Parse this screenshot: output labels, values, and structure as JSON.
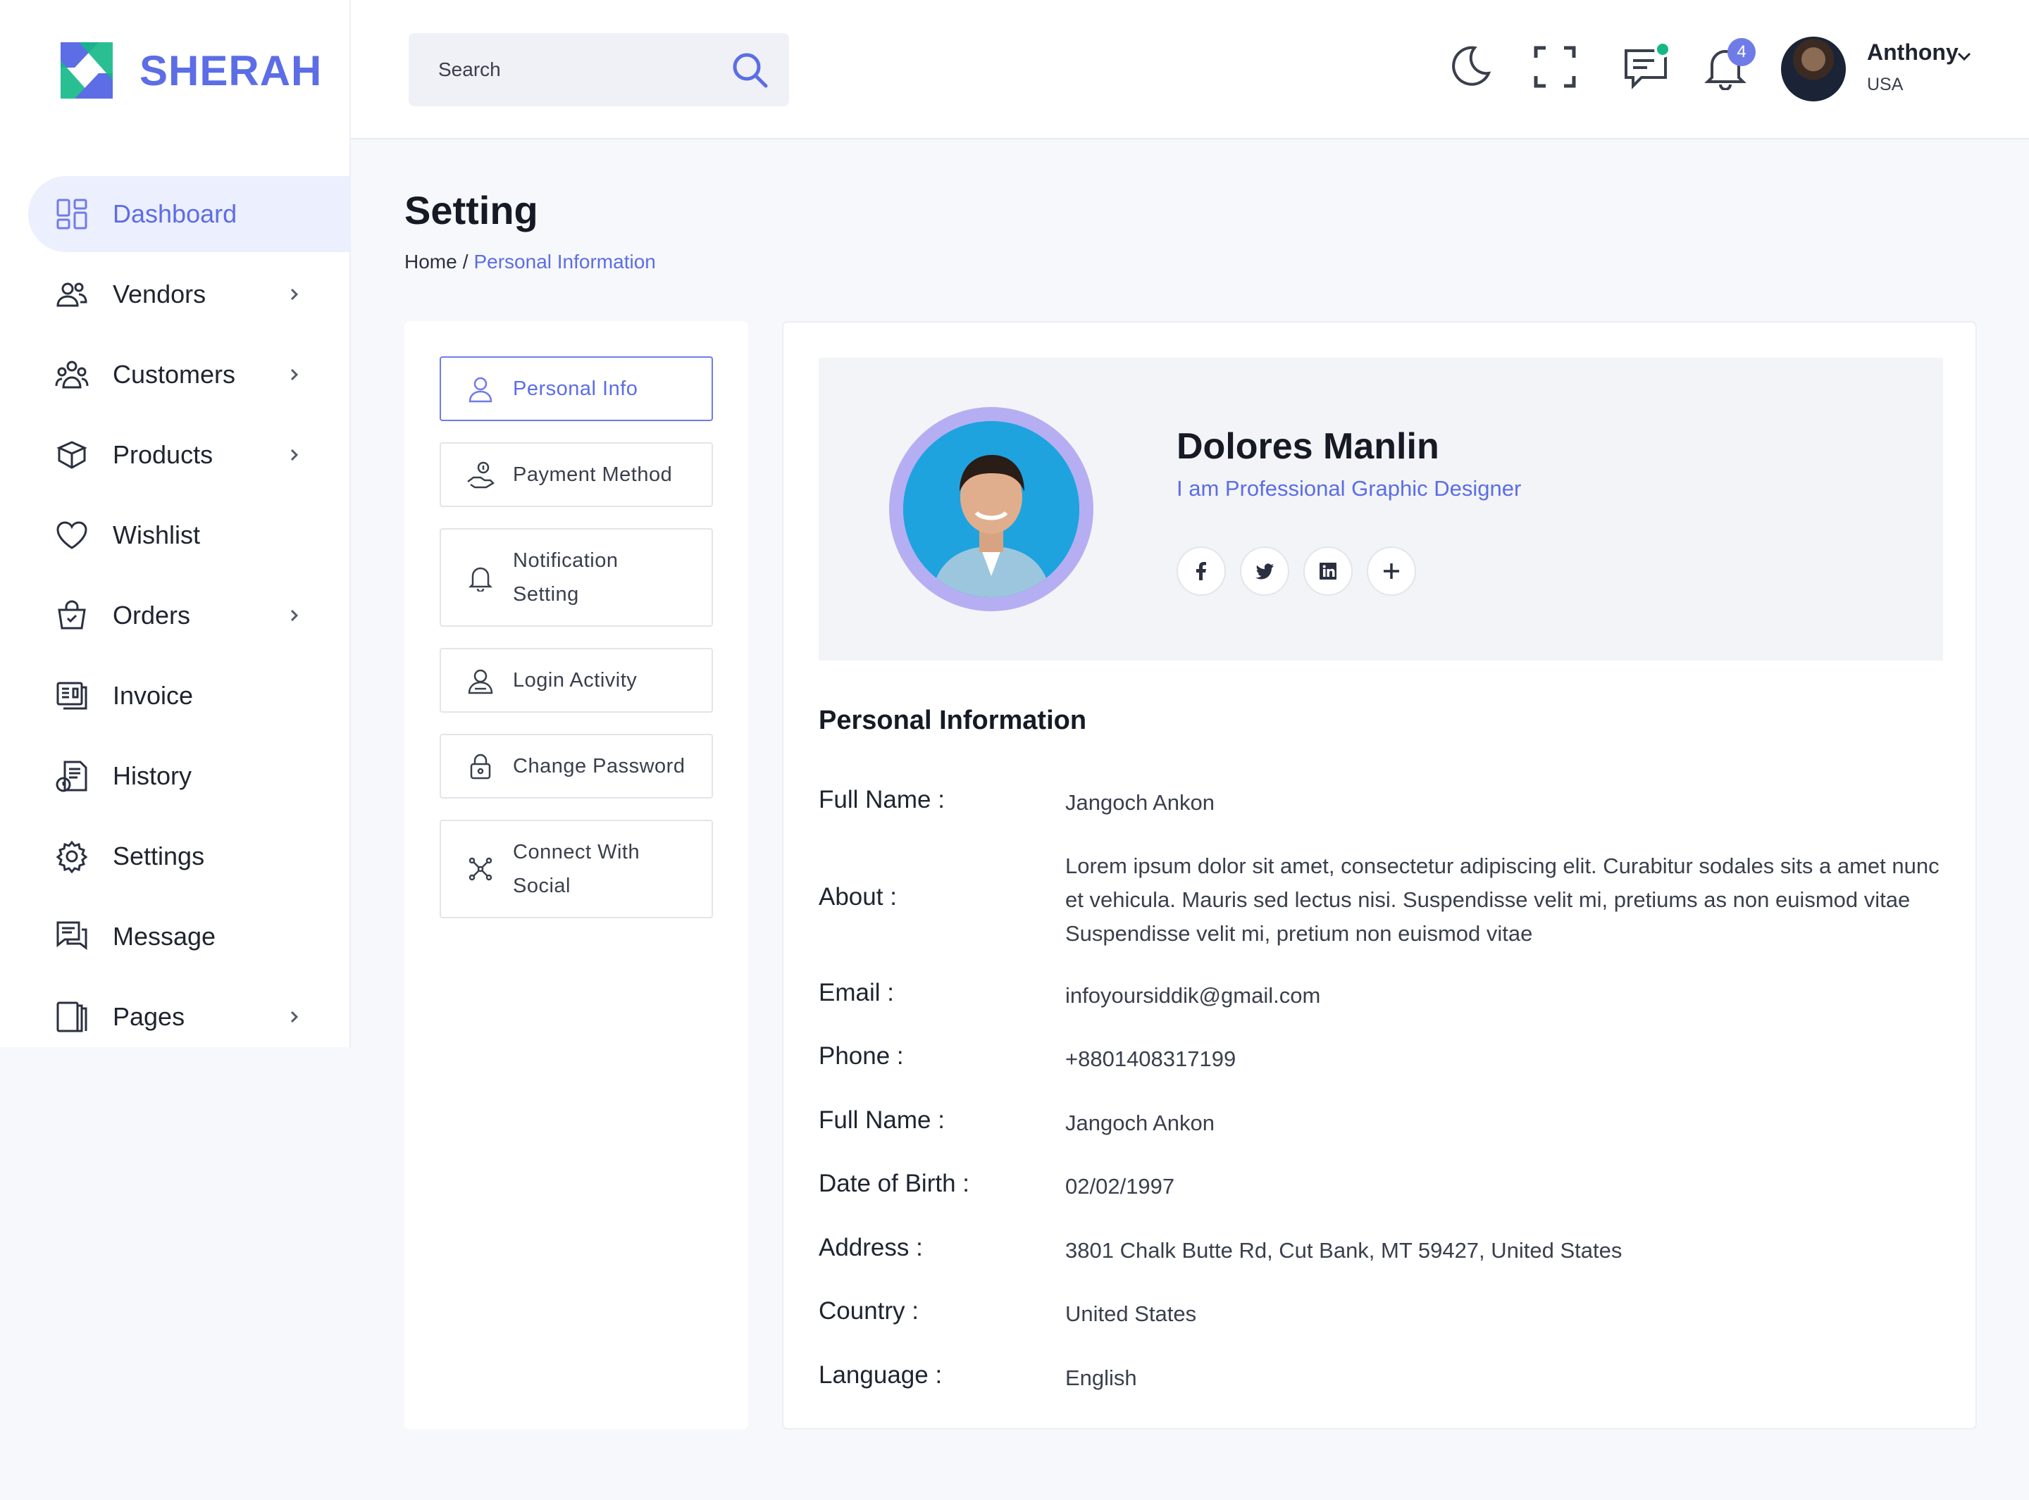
{
  "brand": {
    "name": "SHERAH",
    "logo_icon": "sherah-logo"
  },
  "sidebar": {
    "items": [
      {
        "label": "Dashboard",
        "icon": "dashboard-icon",
        "active": true,
        "has_children": false
      },
      {
        "label": "Vendors",
        "icon": "users-icon",
        "has_children": true
      },
      {
        "label": "Customers",
        "icon": "customers-icon",
        "has_children": true
      },
      {
        "label": "Products",
        "icon": "box-icon",
        "has_children": true
      },
      {
        "label": "Wishlist",
        "icon": "heart-icon",
        "has_children": false
      },
      {
        "label": "Orders",
        "icon": "basket-icon",
        "has_children": true
      },
      {
        "label": "Invoice",
        "icon": "invoice-icon",
        "has_children": false
      },
      {
        "label": "History",
        "icon": "history-icon",
        "has_children": false
      },
      {
        "label": "Settings",
        "icon": "gear-icon",
        "has_children": false
      },
      {
        "label": "Message",
        "icon": "message-icon",
        "has_children": false
      },
      {
        "label": "Pages",
        "icon": "pages-icon",
        "has_children": true
      }
    ]
  },
  "header": {
    "search_placeholder": "Search",
    "notification_count": "4",
    "user": {
      "name": "Anthony",
      "country": "USA"
    }
  },
  "page": {
    "title": "Setting",
    "breadcrumb": {
      "home": "Home",
      "separator": "/",
      "current": "Personal Information"
    }
  },
  "settings_menu": {
    "items": [
      {
        "label": "Personal Info",
        "icon": "user-icon",
        "active": true
      },
      {
        "label": "Payment Method",
        "icon": "payment-icon"
      },
      {
        "label": "Notification Setting",
        "line1": "Notification",
        "line2": "Setting",
        "icon": "bell-icon"
      },
      {
        "label": "Login Activity",
        "icon": "login-activity-icon"
      },
      {
        "label": "Change Password",
        "icon": "lock-icon"
      },
      {
        "label": "Connect With Social",
        "line1": "Connect With",
        "line2": "Social",
        "icon": "share-icon"
      }
    ]
  },
  "profile": {
    "name": "Dolores Manlin",
    "role": "I am Professional Graphic Designer",
    "socials": [
      "facebook-icon",
      "twitter-icon",
      "linkedin-icon",
      "plus-icon"
    ]
  },
  "personal_info": {
    "title": "Personal Information",
    "rows": [
      {
        "label": "Full Name :",
        "value": "Jangoch Ankon"
      },
      {
        "label": "About :",
        "value": "Lorem ipsum dolor sit amet, consectetur adipiscing elit. Curabitur sodales sits a amet nunc et vehicula. Mauris sed lectus nisi. Suspendisse velit mi, pretiums as non euismod vitae Suspendisse velit mi, pretium non euismod vitae"
      },
      {
        "label": "Email :",
        "value": "infoyoursiddik@gmail.com"
      },
      {
        "label": "Phone :",
        "value": "+8801408317199"
      },
      {
        "label": "Full Name :",
        "value": "Jangoch Ankon"
      },
      {
        "label": "Date of Birth :",
        "value": "02/02/1997"
      },
      {
        "label": "Address :",
        "value": "3801 Chalk Butte Rd, Cut Bank, MT 59427, United States"
      },
      {
        "label": "Country :",
        "value": "United States"
      },
      {
        "label": "Language :",
        "value": "English"
      }
    ]
  },
  "colors": {
    "accent": "#5c6de6",
    "accent_light": "#eceffd",
    "online": "#12b886",
    "ring": "#b6aef2"
  }
}
